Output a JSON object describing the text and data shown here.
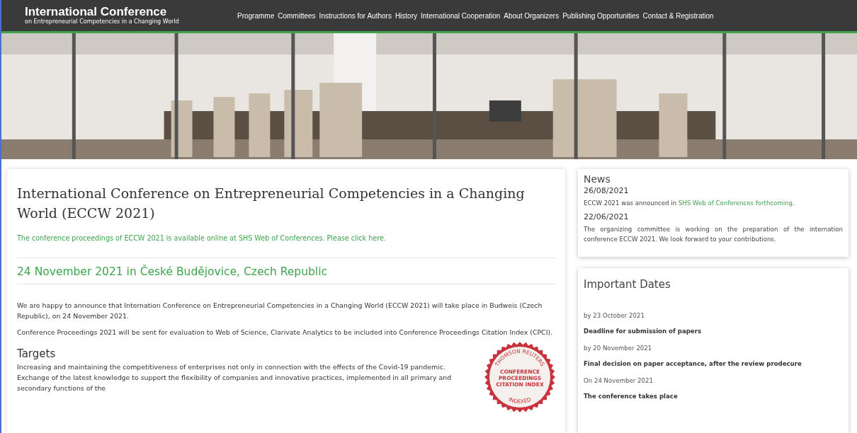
{
  "header": {
    "title": "International Conference",
    "subtitle": "on Entrepreneurial Competencies in a Changing World",
    "nav": [
      "Programme",
      "Committees",
      "Instructions for Authors",
      "History",
      "International Cooperation",
      "About Organizers",
      "Publishing Opportunities",
      "Contact & Registration"
    ]
  },
  "main": {
    "title": "International Conference on Entrepreneurial Competencies in a Changing World (ECCW 2021)",
    "notice": "The conference proceedings of ECCW 2021 is available online at SHS Web of Conferences. Please click here.",
    "date_place": "24 November 2021 in České Budějovice, Czech Republic",
    "paragraphs": [
      "We are happy to announce that Internation Conference on Entrepreneurial Competencies in a Changing World (ECCW 2021) will take place in Budweis (Czech Republic), on 24 November 2021.",
      "Conference Proceedings 2021 will be sent for evaluation to Web of Science, Clarivate Analytics to be included into Conference Proceedings Citation Index (CPCI)."
    ],
    "seal": {
      "top": "THOMSON REUTERS",
      "lines": [
        "CONFERENCE",
        "PROCEEDINGS",
        "CITATION INDEX"
      ],
      "bottom": "INDEXED"
    },
    "targets": {
      "heading": "Targets",
      "text": "Increasing and maintaining the competitiveness of enterprises not only in connection with the effects of the Covid-19 pandemic. Exchange of the latest knowledge to support the flexibility of companies and innovative practices, implemented in all primary and secondary functions of the"
    }
  },
  "news": {
    "heading": "News",
    "items": [
      {
        "date": "26/08/2021",
        "before": "ECCW 2021 was announced in ",
        "link": "SHS Web of Conferences forthcoming",
        "after": "."
      },
      {
        "date": "22/06/2021",
        "before": "The organizing committee is working on the preparation of the internation conference ECCW 2021. We look forward to your contributions."
      }
    ]
  },
  "important_dates": {
    "heading": "Important Dates",
    "items": [
      {
        "when": "by 23 October 2021",
        "what": "Deadline for submission of papers"
      },
      {
        "when": "by 20 November 2021",
        "what": "Final decision on paper acceptance, after the review prodecure"
      },
      {
        "when": "On 24 November 2021",
        "what": "The conference takes place"
      }
    ]
  }
}
